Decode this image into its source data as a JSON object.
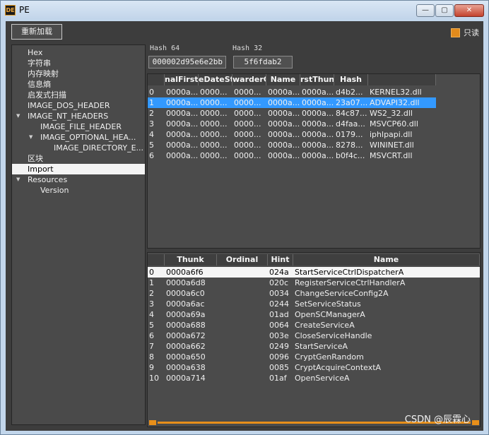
{
  "window": {
    "app_icon": "DE",
    "title": "PE",
    "buttons": {
      "minimize": "—",
      "maximize": "▢",
      "close": "✕"
    }
  },
  "toolbar": {
    "reload_label": "重新加载",
    "readonly_label": "只读",
    "readonly_checked": true,
    "accent": "#e28b1c"
  },
  "tree": {
    "items": [
      {
        "label": "Hex",
        "level": 1,
        "expandable": false,
        "selected": false
      },
      {
        "label": "字符串",
        "level": 1,
        "expandable": false,
        "selected": false
      },
      {
        "label": "内存映射",
        "level": 1,
        "expandable": false,
        "selected": false
      },
      {
        "label": "信息熵",
        "level": 1,
        "expandable": false,
        "selected": false
      },
      {
        "label": "启发式扫描",
        "level": 1,
        "expandable": false,
        "selected": false
      },
      {
        "label": "IMAGE_DOS_HEADER",
        "level": 1,
        "expandable": false,
        "selected": false
      },
      {
        "label": "IMAGE_NT_HEADERS",
        "level": 1,
        "expandable": true,
        "selected": false
      },
      {
        "label": "IMAGE_FILE_HEADER",
        "level": 2,
        "expandable": false,
        "selected": false
      },
      {
        "label": "IMAGE_OPTIONAL_HEA...",
        "level": 2,
        "expandable": true,
        "selected": false
      },
      {
        "label": "IMAGE_DIRECTORY_E...",
        "level": 3,
        "expandable": false,
        "selected": false
      },
      {
        "label": "区块",
        "level": 1,
        "expandable": false,
        "selected": false
      },
      {
        "label": "Import",
        "level": 1,
        "expandable": false,
        "selected": true
      },
      {
        "label": "Resources",
        "level": 1,
        "expandable": true,
        "selected": false
      },
      {
        "label": "Version",
        "level": 2,
        "expandable": false,
        "selected": false
      }
    ]
  },
  "hash": {
    "hash64_label": "Hash 64",
    "hash64_value": "000002d95e6e2bb",
    "hash32_label": "Hash 32",
    "hash32_value": "5f6fdab2"
  },
  "import_table": {
    "columns": [
      "",
      "nalFirstT",
      "eDateSt",
      "warderC",
      "Name",
      "rstThun",
      "Hash",
      ""
    ],
    "selected_row": 1,
    "rows": [
      [
        "0",
        "0000a...",
        "0000...",
        "0000...",
        "0000a...",
        "0000a...",
        "d4b2...",
        "KERNEL32.dll"
      ],
      [
        "1",
        "0000a...",
        "0000...",
        "0000...",
        "0000a...",
        "0000a...",
        "23a07...",
        "ADVAPI32.dll"
      ],
      [
        "2",
        "0000a...",
        "0000...",
        "0000...",
        "0000a...",
        "0000a...",
        "84c87...",
        "WS2_32.dll"
      ],
      [
        "3",
        "0000a...",
        "0000...",
        "0000...",
        "0000a...",
        "0000a...",
        "d4faa...",
        "MSVCP60.dll"
      ],
      [
        "4",
        "0000a...",
        "0000...",
        "0000...",
        "0000a...",
        "0000a...",
        "0179...",
        "iphlpapi.dll"
      ],
      [
        "5",
        "0000a...",
        "0000...",
        "0000...",
        "0000a...",
        "0000a...",
        "8278...",
        "WININET.dll"
      ],
      [
        "6",
        "0000a...",
        "0000...",
        "0000...",
        "0000a...",
        "0000a...",
        "b0f4c...",
        "MSVCRT.dll"
      ]
    ]
  },
  "thunk_table": {
    "columns": [
      "",
      "Thunk",
      "Ordinal",
      "Hint",
      "Name"
    ],
    "selected_row": 0,
    "rows": [
      [
        "0",
        "0000a6f6",
        "",
        "024a",
        "StartServiceCtrlDispatcherA"
      ],
      [
        "1",
        "0000a6d8",
        "",
        "020c",
        "RegisterServiceCtrlHandlerA"
      ],
      [
        "2",
        "0000a6c0",
        "",
        "0034",
        "ChangeServiceConfig2A"
      ],
      [
        "3",
        "0000a6ac",
        "",
        "0244",
        "SetServiceStatus"
      ],
      [
        "4",
        "0000a69a",
        "",
        "01ad",
        "OpenSCManagerA"
      ],
      [
        "5",
        "0000a688",
        "",
        "0064",
        "CreateServiceA"
      ],
      [
        "6",
        "0000a672",
        "",
        "003e",
        "CloseServiceHandle"
      ],
      [
        "7",
        "0000a662",
        "",
        "0249",
        "StartServiceA"
      ],
      [
        "8",
        "0000a650",
        "",
        "0096",
        "CryptGenRandom"
      ],
      [
        "9",
        "0000a638",
        "",
        "0085",
        "CryptAcquireContextA"
      ],
      [
        "10",
        "0000a714",
        "",
        "01af",
        "OpenServiceA"
      ]
    ]
  },
  "watermark": "CSDN @辰霖心"
}
